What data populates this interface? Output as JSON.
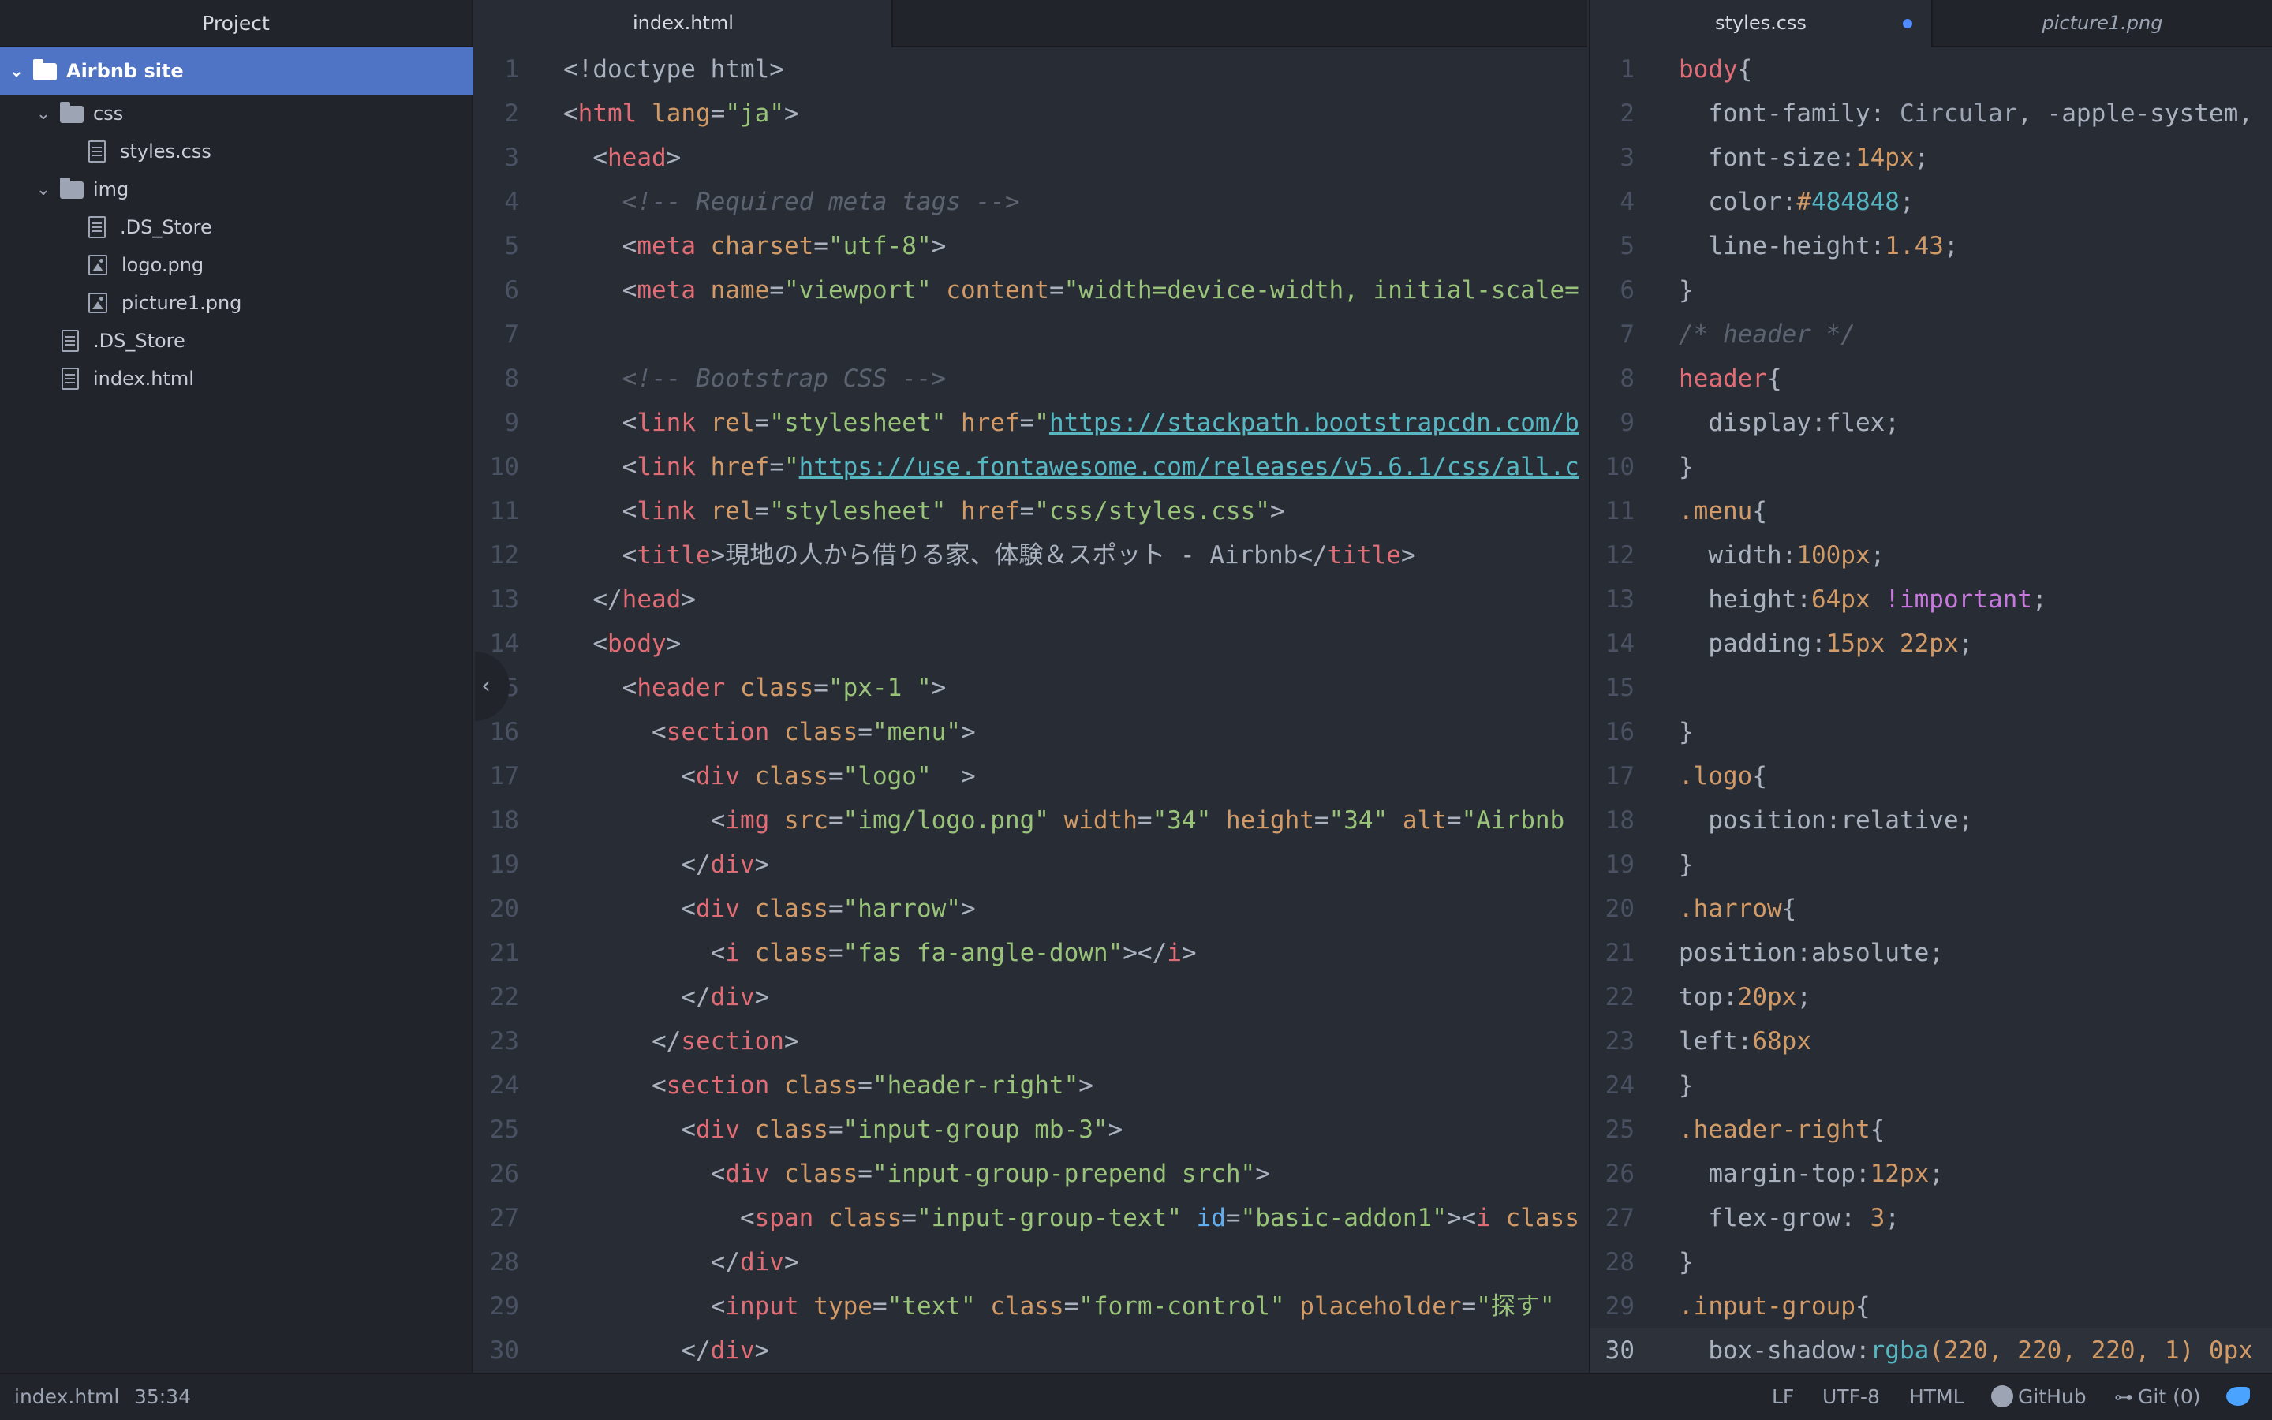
{
  "sidebar": {
    "title": "Project",
    "items": [
      {
        "label": "Airbnb site",
        "kind": "folder",
        "depth": 0,
        "expanded": true,
        "selected": true
      },
      {
        "label": "css",
        "kind": "folder",
        "depth": 1,
        "expanded": true
      },
      {
        "label": "styles.css",
        "kind": "file",
        "depth": 2
      },
      {
        "label": "img",
        "kind": "folder",
        "depth": 1,
        "expanded": true
      },
      {
        "label": ".DS_Store",
        "kind": "file",
        "depth": 2
      },
      {
        "label": "logo.png",
        "kind": "image",
        "depth": 2
      },
      {
        "label": "picture1.png",
        "kind": "image",
        "depth": 2
      },
      {
        "label": ".DS_Store",
        "kind": "file",
        "depth": 1
      },
      {
        "label": "index.html",
        "kind": "file",
        "depth": 1
      }
    ]
  },
  "left_pane": {
    "tabs": [
      {
        "label": "index.html",
        "active": true
      }
    ],
    "line_numbers": [
      "1",
      "2",
      "3",
      "4",
      "5",
      "6",
      "7",
      "8",
      "9",
      "10",
      "11",
      "12",
      "13",
      "14",
      "5",
      "16",
      "17",
      "18",
      "19",
      "20",
      "21",
      "22",
      "23",
      "24",
      "25",
      "26",
      "27",
      "28",
      "29",
      "30"
    ],
    "lines": {
      "l1": "<!doctype html>",
      "l2_t1": "<",
      "l2_tag": "html",
      "l2_attr": " lang",
      "l2_eq": "=",
      "l2_val": "\"ja\"",
      "l2_end": ">",
      "l3_tag": "head",
      "l4": "<!-- Required meta tags -->",
      "l5_tag": "meta",
      "l5_attr": " charset",
      "l5_val": "\"utf-8\"",
      "l6_tag": "meta",
      "l6_attr1": " name",
      "l6_val1": "\"viewport\"",
      "l6_attr2": " content",
      "l6_val2": "\"width=device-width, initial-scale=",
      "l8": "<!-- Bootstrap CSS -->",
      "l9_tag": "link",
      "l9_attr1": " rel",
      "l9_val1": "\"stylesheet\"",
      "l9_attr2": " href",
      "l9_q": "\"",
      "l9_url": "https://stackpath.bootstrapcdn.com/b",
      "l10_tag": "link",
      "l10_attr": " href",
      "l10_q": "\"",
      "l10_url": "https://use.fontawesome.com/releases/v5.6.1/css/all.c",
      "l11_tag": "link",
      "l11_attr1": " rel",
      "l11_val1": "\"stylesheet\"",
      "l11_attr2": " href",
      "l11_val2": "\"css/styles.css\"",
      "l12_tag": "title",
      "l12_text": "現地の人から借りる家、体験＆スポット - Airbnb",
      "l13_tag": "head",
      "l14_tag": "body",
      "l15_tag": "header",
      "l15_attr": " class",
      "l15_val": "\"px-1 \"",
      "l16_tag": "section",
      "l16_attr": " class",
      "l16_val": "\"menu\"",
      "l17_tag": "div",
      "l17_attr": " class",
      "l17_val": "\"logo\"",
      "l17_rest": "  >",
      "l18_tag": "img",
      "l18_attr1": " src",
      "l18_val1": "\"img/logo.png\"",
      "l18_attr2": " width",
      "l18_val2": "\"34\"",
      "l18_attr3": " height",
      "l18_val3": "\"34\"",
      "l18_attr4": " alt",
      "l18_val4": "\"Airbnb",
      "l19_tag": "div",
      "l20_tag": "div",
      "l20_attr": " class",
      "l20_val": "\"harrow\"",
      "l21_tag": "i",
      "l21_attr": " class",
      "l21_val": "\"fas fa-angle-down\"",
      "l22_tag": "div",
      "l23_tag": "section",
      "l24_tag": "section",
      "l24_attr": " class",
      "l24_val": "\"header-right\"",
      "l25_tag": "div",
      "l25_attr": " class",
      "l25_val": "\"input-group mb-3\"",
      "l26_tag": "div",
      "l26_attr": " class",
      "l26_val": "\"input-group-prepend srch\"",
      "l27_tag": "span",
      "l27_attr1": " class",
      "l27_val1": "\"input-group-text\"",
      "l27_attr2": " id",
      "l27_val2": "\"basic-addon1\"",
      "l27_tag2": "i",
      "l27_attr3": " class",
      "l28_tag": "div",
      "l29_tag": "input",
      "l29_attr1": " type",
      "l29_val1": "\"text\"",
      "l29_attr2": " class",
      "l29_val2": "\"form-control\"",
      "l29_attr3": " placeholder",
      "l29_val3": "\"探す\"",
      "l30_tag": "div"
    }
  },
  "right_pane": {
    "tabs": [
      {
        "label": "styles.css",
        "active": true,
        "modified": true
      },
      {
        "label": "picture1.png",
        "active": false
      }
    ],
    "line_numbers": [
      "1",
      "2",
      "3",
      "4",
      "5",
      "6",
      "7",
      "8",
      "9",
      "10",
      "11",
      "12",
      "13",
      "14",
      "15",
      "16",
      "17",
      "18",
      "19",
      "20",
      "21",
      "22",
      "23",
      "24",
      "25",
      "26",
      "27",
      "28",
      "29",
      "30"
    ],
    "lines": {
      "r1_sel": "body",
      "r1_b": "{",
      "r2_p": "  font-family: ",
      "r2_v1": "Circular",
      "r2_v2": ", -apple-system,",
      "r3_p": "  font-size:",
      "r3_v": "14px",
      "r3_e": ";",
      "r4_p": "  color:",
      "r4_h": "#",
      "r4_v": "484848",
      "r4_e": ";",
      "r5_p": "  line-height:",
      "r5_v": "1.43",
      "r5_e": ";",
      "r6": "}",
      "r7": "/* header */",
      "r8_sel": "header",
      "r8_b": "{",
      "r9": "  display:flex;",
      "r10": "}",
      "r11_sel": ".menu",
      "r11_b": "{",
      "r12_p": "  width:",
      "r12_v": "100px",
      "r12_e": ";",
      "r13_p": "  height:",
      "r13_v": "64px",
      "r13_k": " !important",
      "r13_e": ";",
      "r14_p": "  padding:",
      "r14_v": "15px 22px",
      "r14_e": ";",
      "r16": "}",
      "r17_sel": ".logo",
      "r17_b": "{",
      "r18": "  position:relative;",
      "r19": "}",
      "r20_sel": ".harrow",
      "r20_b": "{",
      "r21": "position:absolute;",
      "r22_p": "top:",
      "r22_v": "20px",
      "r22_e": ";",
      "r23_p": "left:",
      "r23_v": "68px",
      "r24": "}",
      "r25_sel": ".header-right",
      "r25_b": "{",
      "r26_p": "  margin-top:",
      "r26_v": "12px",
      "r26_e": ";",
      "r27_p": "  flex-grow: ",
      "r27_v": "3",
      "r27_e": ";",
      "r28": "}",
      "r29_sel": ".input-group",
      "r29_b": "{",
      "r30_p": "  box-shadow:",
      "r30_f": "rgba",
      "r30_v": "(220, 220, 220, 1) 0px"
    }
  },
  "statusbar": {
    "file": "index.html",
    "cursor": "35:34",
    "line_ending": "LF",
    "encoding": "UTF-8",
    "grammar": "HTML",
    "github": "GitHub",
    "git": "Git (0)"
  },
  "colors": {
    "accent": "#4f74c6",
    "background": "#282c34",
    "sidebar": "#21252b"
  },
  "icons": [
    "chevron-down-icon",
    "folder-icon",
    "file-icon",
    "image-file-icon",
    "chevron-left-icon",
    "github-icon",
    "git-icon",
    "bird-icon"
  ]
}
